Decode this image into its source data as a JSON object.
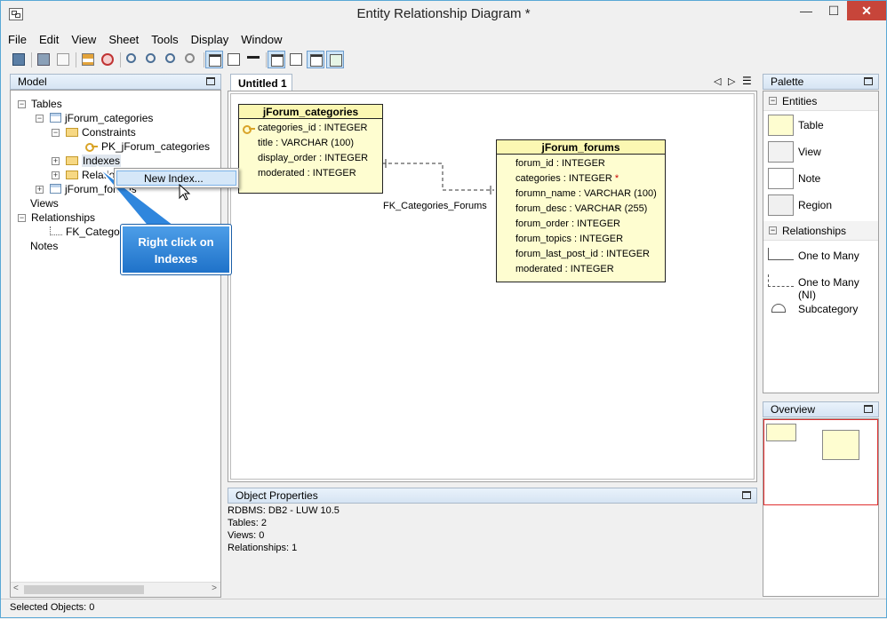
{
  "window": {
    "title": "Entity Relationship Diagram *",
    "min_glyph": "—",
    "max_glyph": "☐",
    "close_glyph": "✕"
  },
  "menu": [
    "File",
    "Edit",
    "View",
    "Sheet",
    "Tools",
    "Display",
    "Window"
  ],
  "model_panel": {
    "title": "Model",
    "tree": {
      "tables_label": "Tables",
      "table1": "jForum_categories",
      "constraints": "Constraints",
      "pk": "PK_jForum_categories",
      "indexes": "Indexes",
      "relations": "Relatio",
      "table2": "jForum_forums",
      "views": "Views",
      "relationships": "Relationships",
      "fk": "FK_Categorie",
      "notes": "Notes"
    }
  },
  "context_menu": {
    "item": "New Index..."
  },
  "callout": {
    "line1": "Right click on",
    "line2": "Indexes"
  },
  "editor": {
    "tab": "Untitled 1",
    "nav_left": "◁",
    "nav_right": "▷",
    "nav_list": "☰",
    "relationship_label": "FK_Categories_Forums",
    "entity1": {
      "name": "jForum_categories",
      "columns": [
        "categories_id : INTEGER",
        "title : VARCHAR (100)",
        "display_order : INTEGER",
        "moderated : INTEGER"
      ]
    },
    "entity2": {
      "name": "jForum_forums",
      "columns": [
        "forum_id : INTEGER",
        "categories : INTEGER",
        "forumn_name : VARCHAR (100)",
        "forum_desc : VARCHAR (255)",
        "forum_order : INTEGER",
        "forum_topics : INTEGER",
        "forum_last_post_id : INTEGER",
        "moderated : INTEGER"
      ],
      "fk_marker": "*"
    }
  },
  "properties": {
    "title": "Object Properties",
    "lines": [
      "RDBMS: DB2 - LUW 10.5",
      "Tables: 2",
      "Views: 0",
      "Relationships: 1"
    ]
  },
  "palette": {
    "title": "Palette",
    "entities_section": "Entities",
    "entities": [
      "Table",
      "View",
      "Note",
      "Region"
    ],
    "relationships_section": "Relationships",
    "relationships": [
      "One to Many",
      "One to Many (NI)",
      "Subcategory"
    ]
  },
  "overview": {
    "title": "Overview"
  },
  "status": {
    "text": "Selected Objects: 0"
  },
  "colors": {
    "entity_fill": "#fefdd0",
    "accent": "#1f72c9",
    "close": "#c7453a"
  }
}
